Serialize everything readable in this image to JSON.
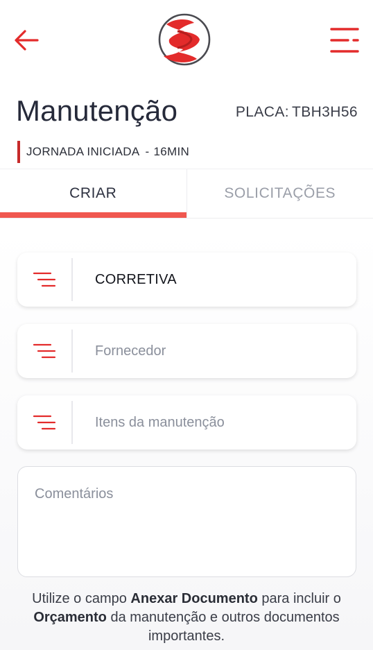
{
  "header": {
    "back_icon": "arrow-left-icon",
    "logo_icon": "brand-logo",
    "menu_icon": "menu-icon",
    "accent_color": "#e32b2b"
  },
  "page": {
    "title": "Manutenção",
    "plate_label": "PLACA:",
    "plate_value": "TBH3H56"
  },
  "status": {
    "label": "JORNADA INICIADA",
    "separator": "-",
    "elapsed": "16MIN"
  },
  "tabs": [
    {
      "label": "CRIAR",
      "active": true
    },
    {
      "label": "SOLICITAÇÕES",
      "active": false
    }
  ],
  "form": {
    "type": {
      "value": "CORRETIVA",
      "icon": "list-icon"
    },
    "supplier": {
      "placeholder": "Fornecedor",
      "icon": "list-icon"
    },
    "items": {
      "placeholder": "Itens da manutenção",
      "icon": "list-icon"
    },
    "comments": {
      "placeholder": "Comentários"
    }
  },
  "hint": {
    "part1": "Utilize o campo ",
    "bold1": "Anexar Documento",
    "part2": " para incluir o ",
    "bold2": "Orçamento",
    "part3": " da manutenção e outros documentos importantes."
  }
}
